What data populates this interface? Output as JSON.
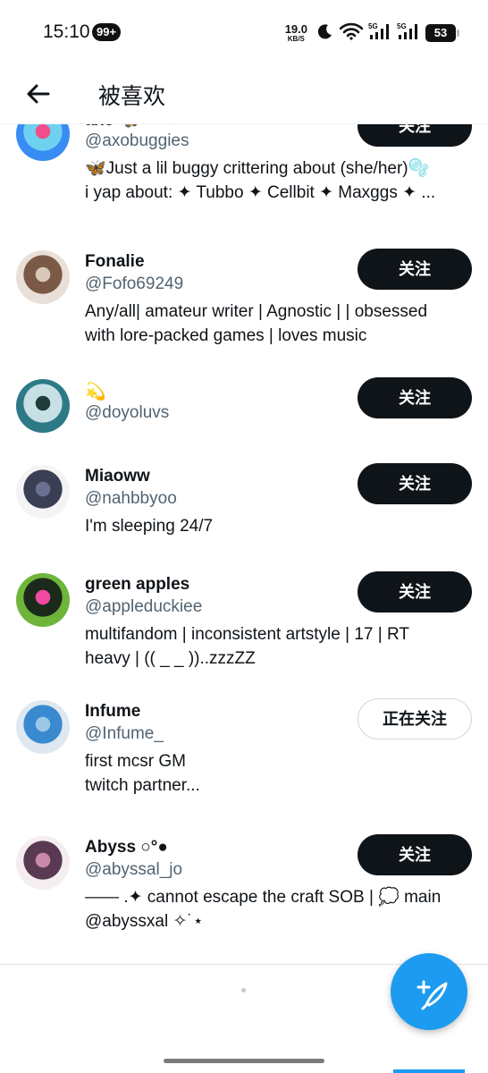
{
  "status_bar": {
    "time": "15:10",
    "notification_badge": "99+",
    "net_speed_value": "19.0",
    "net_speed_unit": "KB/S",
    "network_1": "5G",
    "network_2": "5G",
    "battery": "53"
  },
  "header": {
    "title": "被喜欢"
  },
  "users": [
    {
      "name": "axo 🦋 ✦ ✦ ⋆",
      "handle": "@axobuggies",
      "bio": [
        "🦋Just a lil buggy crittering about (she/her)🫧",
        "i yap about: ✦ Tubbo ✦ Cellbit ✦ Maxggs ✦ ..."
      ],
      "button": "关注",
      "following": false,
      "avatar_colors": [
        "#3a8cf5",
        "#6fd1f0",
        "#f04d8a"
      ]
    },
    {
      "name": "Fonalie",
      "handle": "@Fofo69249",
      "bio": [
        "Any/all| amateur writer | Agnostic | | obsessed",
        "with lore-packed games | loves music"
      ],
      "button": "关注",
      "following": false,
      "avatar_colors": [
        "#e8e0d8",
        "#7a5a46",
        "#d8c8b8"
      ]
    },
    {
      "name": "💫",
      "handle": "@doyoluvs",
      "bio": [],
      "button": "关注",
      "following": false,
      "avatar_colors": [
        "#2d7a86",
        "#c7e0e6",
        "#1e3c3a"
      ]
    },
    {
      "name": "Miaoww",
      "handle": "@nahbbyoo",
      "bio": [
        "I'm sleeping 24/7"
      ],
      "button": "关注",
      "following": false,
      "avatar_colors": [
        "#f4f4f6",
        "#3a3f55",
        "#6a7090"
      ]
    },
    {
      "name": "green apples",
      "handle": "@appleduckiee",
      "bio": [
        "multifandom | inconsistent artstyle | 17 | RT",
        "heavy | (( _ _ ))..zzzZZ"
      ],
      "button": "关注",
      "following": false,
      "avatar_colors": [
        "#6fb53a",
        "#1c2a1c",
        "#f24aa0"
      ]
    },
    {
      "name": "Infume",
      "handle": "@Infume_",
      "bio": [
        "first mcsr GM",
        "twitch partner..."
      ],
      "button": "正在关注",
      "following": true,
      "avatar_colors": [
        "#dfe8f0",
        "#3a8ad0",
        "#9cc8e8"
      ]
    },
    {
      "name": "Abyss ○°●",
      "handle": "@abyssal_jo",
      "bio": [
        "—— .✦ cannot escape the craft SOB | 💭 main",
        "@abyssxal ✧˙⋆"
      ],
      "button": "关注",
      "following": false,
      "avatar_colors": [
        "#f5eef0",
        "#5a3a52",
        "#c88aa8"
      ]
    }
  ],
  "colors": {
    "accent": "#1d9bf0",
    "text": "#0f1419",
    "secondary_text": "#536471",
    "button_dark": "#0f1419"
  }
}
